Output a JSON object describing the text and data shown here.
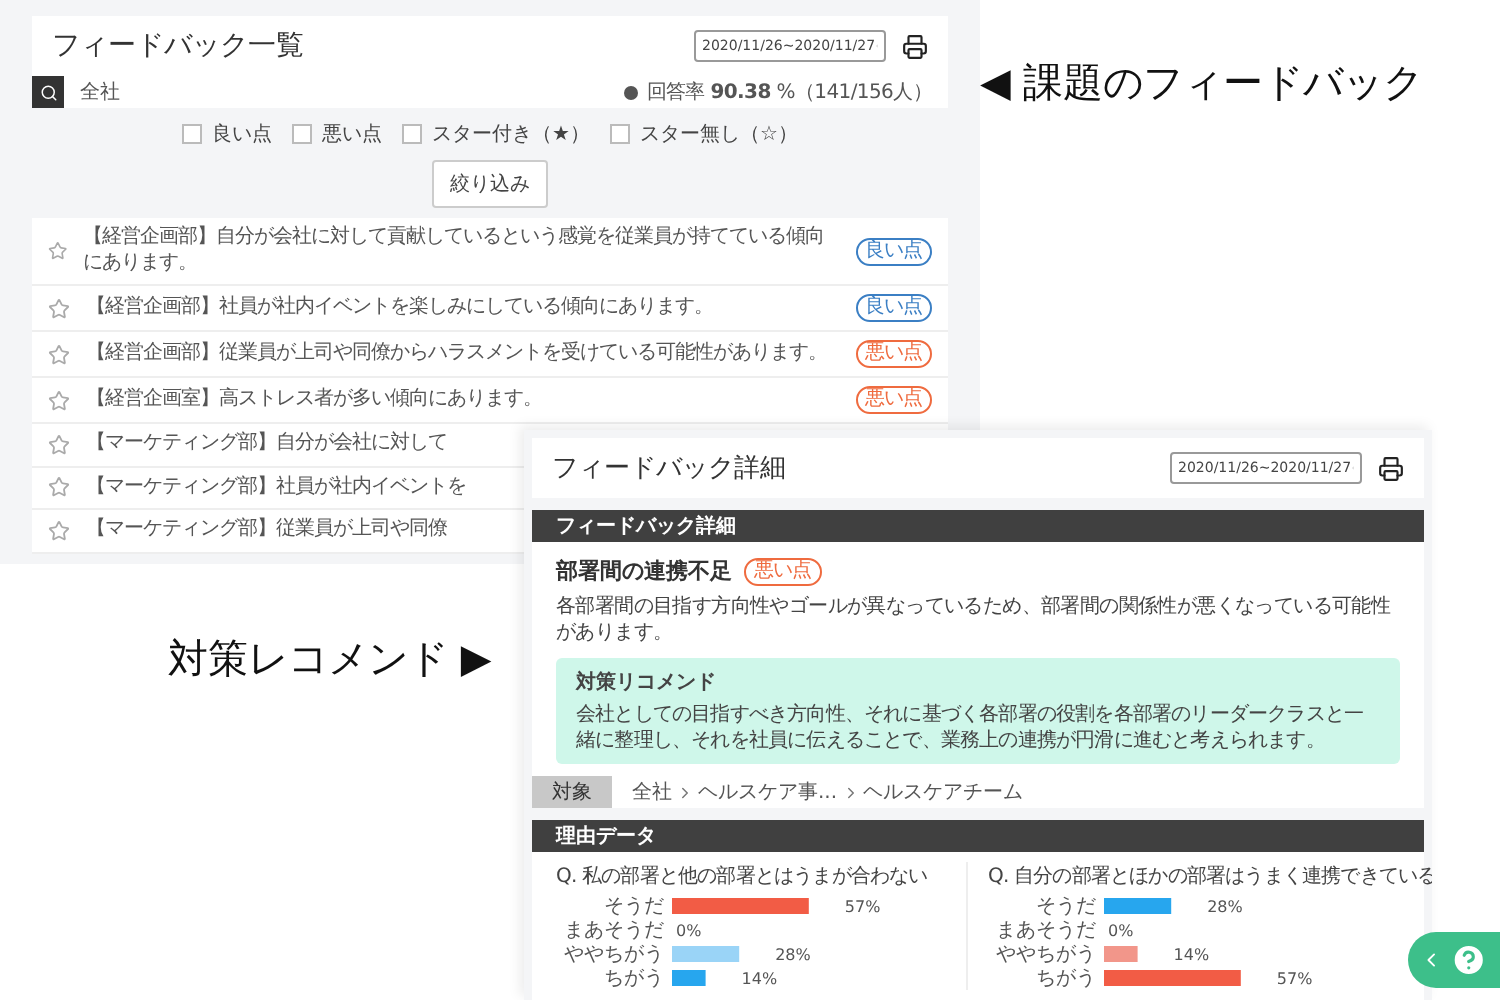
{
  "list_page": {
    "title": "フィードバック一覧",
    "date_range": "2020/11/26~2020/11/27",
    "scope": "全社",
    "response_rate": "回答率 **90.38** %（141/156人）",
    "filters": [
      {
        "label": "良い点",
        "checked": false
      },
      {
        "label": "悪い点",
        "checked": false
      },
      {
        "label": "スター付き（★）",
        "checked": false
      },
      {
        "label": "スター無し（☆）",
        "checked": false
      }
    ],
    "filter_button": "絞り込み",
    "rows": [
      {
        "text": "【経営企画部】自分が会社に対して貢献しているという感覚を従業員が持てている傾向にあります。",
        "starred": false,
        "badge": {
          "label": "良い点",
          "kind": "good"
        }
      },
      {
        "text": "【経営企画部】社員が社内イベントを楽しみにしている傾向にあります。",
        "starred": false,
        "badge": {
          "label": "良い点",
          "kind": "good"
        }
      },
      {
        "text": "【経営企画部】従業員が上司や同僚からハラスメントを受けている可能性があります。",
        "starred": false,
        "badge": {
          "label": "悪い点",
          "kind": "bad"
        }
      },
      {
        "text": "【経営企画室】高ストレス者が多い傾向にあります。",
        "starred": false,
        "badge": {
          "label": "悪い点",
          "kind": "bad"
        }
      },
      {
        "text": "【マーケティング部】自分が会社に対して",
        "starred": false
      },
      {
        "text": "【マーケティング部】社員が社内イベントを",
        "starred": false
      },
      {
        "text": "【マーケティング部】従業員が上司や同僚",
        "starred": false
      }
    ]
  },
  "detail_page": {
    "title": "フィードバック詳細",
    "date_range": "2020/11/26~2020/11/27",
    "feedback_section": {
      "heading": "フィードバック詳細",
      "issue": "部署間の連携不足",
      "badge": {
        "label": "悪い点",
        "kind": "bad"
      },
      "description": "各部署間の目指す方向性やゴールが異なっているため、部署間の関係性が悪くなっている可能性があります。",
      "recommendation": {
        "title": "対策リコメンド",
        "text": "会社としての目指すべき方向性、それに基づく各部署の役割を各部署のリーダークラスと一緒に整理し、それを社員に伝えることで、業務上の連携が円滑に進むと考えられます。"
      }
    },
    "target": {
      "label": "対象",
      "path": [
        "全社",
        "ヘルスケア事...",
        "ヘルスケアチーム"
      ]
    },
    "reasons_section": {
      "heading": "理由データ",
      "charts": [
        {
          "chart_data": {
            "type": "bar",
            "orientation": "horizontal",
            "title": "Q. 私の部署と他の部署とはうまが合わない",
            "categories": [
              "そうだ",
              "まあそうだ",
              "ややちがう",
              "ちがう"
            ],
            "values": [
              57,
              0,
              28,
              14
            ],
            "colors": [
              "#f25c45",
              null,
              "#9ad4f7",
              "#27a6ee"
            ],
            "value_labels": [
              "57%",
              "0%",
              "28%",
              "14%"
            ]
          }
        },
        {
          "chart_data": {
            "type": "bar",
            "orientation": "horizontal",
            "title": "Q. 自分の部署とほかの部署はうまく連携できている",
            "categories": [
              "そうだ",
              "まあそうだ",
              "ややちがう",
              "ちがう"
            ],
            "values": [
              28,
              0,
              14,
              57
            ],
            "colors": [
              "#27a6ee",
              null,
              "#f2968a",
              "#f25c45"
            ],
            "value_labels": [
              "28%",
              "0%",
              "14%",
              "57%"
            ]
          }
        }
      ]
    }
  },
  "callouts": [
    {
      "text": "◀ 課題のフィードバック"
    },
    {
      "text": "対策レコメンド ▶"
    }
  ]
}
